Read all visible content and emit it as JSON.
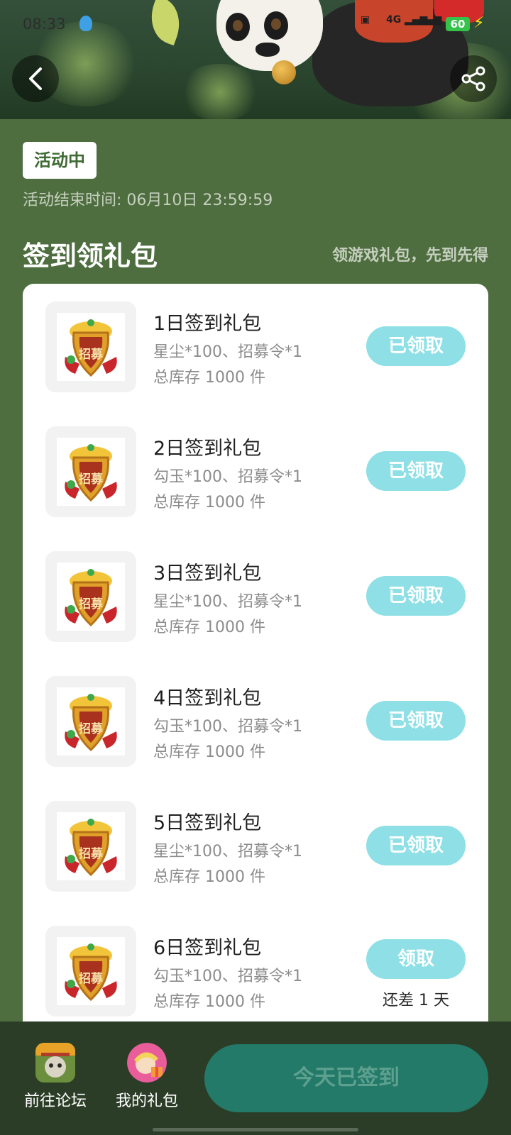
{
  "status_bar": {
    "time": "08:33",
    "network_label": "4G",
    "battery": "60"
  },
  "header": {
    "status_tag": "活动中",
    "end_time": "活动结束时间: 06月10日 23:59:59"
  },
  "section": {
    "title": "签到领礼包",
    "subtitle": "领游戏礼包，先到先得"
  },
  "gifts": [
    {
      "name": "1日签到礼包",
      "content": "星尘*100、招募令*1",
      "stock": "总库存 1000 件",
      "button": "已领取",
      "note": ""
    },
    {
      "name": "2日签到礼包",
      "content": "勾玉*100、招募令*1",
      "stock": "总库存 1000 件",
      "button": "已领取",
      "note": ""
    },
    {
      "name": "3日签到礼包",
      "content": "星尘*100、招募令*1",
      "stock": "总库存 1000 件",
      "button": "已领取",
      "note": ""
    },
    {
      "name": "4日签到礼包",
      "content": "勾玉*100、招募令*1",
      "stock": "总库存 1000 件",
      "button": "已领取",
      "note": ""
    },
    {
      "name": "5日签到礼包",
      "content": "星尘*100、招募令*1",
      "stock": "总库存 1000 件",
      "button": "已领取",
      "note": ""
    },
    {
      "name": "6日签到礼包",
      "content": "勾玉*100、招募令*1",
      "stock": "总库存 1000 件",
      "button": "领取",
      "note": "还差 1 天"
    }
  ],
  "gift_icon_text": "招募",
  "bottom": {
    "forum_label": "前往论坛",
    "mygifts_label": "我的礼包",
    "signin_label": "今天已签到"
  },
  "colors": {
    "page_bg": "#4e6e3f",
    "button_bg": "#8ee0e6",
    "signin_bg": "#237a68",
    "bottom_bg": "#2b3d27"
  }
}
